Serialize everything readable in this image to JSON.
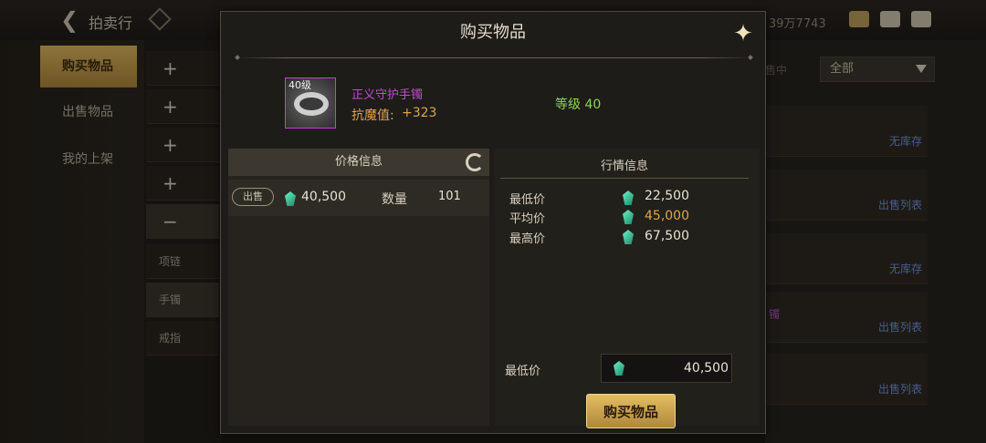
{
  "background": {
    "title": "拍卖行",
    "currency_partial": "39万7743",
    "sidebar": [
      {
        "label": "购买物品",
        "active": true
      },
      {
        "label": "出售物品",
        "active": false
      },
      {
        "label": "我的上架",
        "active": false
      }
    ],
    "categories": [
      "+",
      "+",
      "+",
      "+",
      "−",
      "项链",
      "手镯",
      "戒指"
    ],
    "filter_value": "全部",
    "filter_partial_label": "售中",
    "right_rows": [
      "无库存",
      "出售列表",
      "无库存",
      "出售列表",
      "出售列表"
    ],
    "purple_partial": "镯"
  },
  "modal": {
    "title": "购买物品",
    "item": {
      "level_badge": "40级",
      "name": "正义守护手镯",
      "stat_label": "抗魔值:",
      "stat_value": "+323",
      "grade": "等级 40",
      "rarity_color": "#c748d8"
    },
    "price_panel": {
      "header": "价格信息",
      "row": {
        "badge": "出售",
        "price": "40,500",
        "qty_label": "数量",
        "qty": "101"
      }
    },
    "market_panel": {
      "header": "行情信息",
      "rows": [
        {
          "label": "最低价",
          "value": "22,500"
        },
        {
          "label": "平均价",
          "value": "45,000"
        },
        {
          "label": "最高价",
          "value": "67,500"
        }
      ]
    },
    "min_price_label": "最低价",
    "min_price_value": "40,500",
    "buy_button": "购买物品"
  },
  "colors": {
    "accent_gold": "#d9b35a",
    "gem": "#3fd3a2",
    "grade_green": "#8bd84a"
  }
}
